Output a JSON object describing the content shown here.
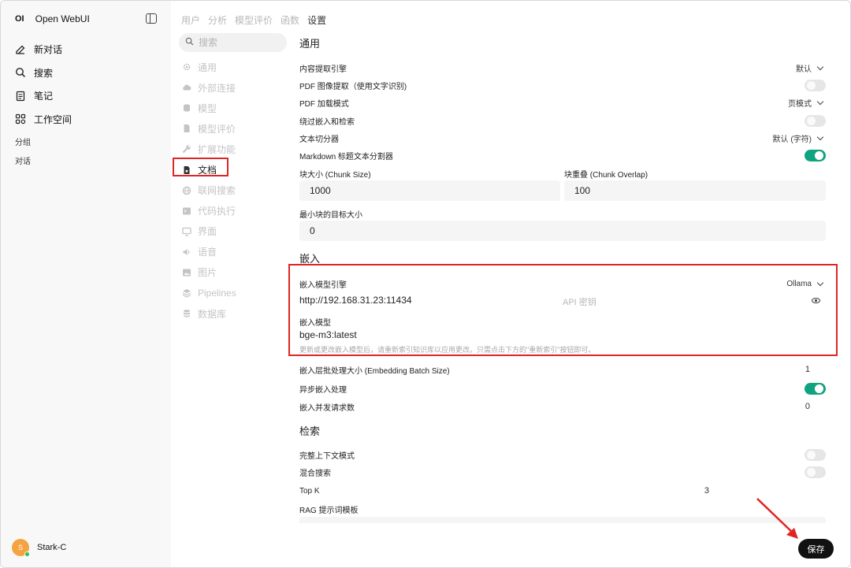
{
  "app": {
    "logo": "OI",
    "name": "Open WebUI"
  },
  "sidebar": {
    "items": [
      {
        "label": "新对话",
        "icon": "edit-icon"
      },
      {
        "label": "搜索",
        "icon": "search-icon"
      },
      {
        "label": "笔记",
        "icon": "note-icon"
      },
      {
        "label": "工作空间",
        "icon": "workspace-icon"
      }
    ],
    "groups_label": "分组",
    "chats_label": "对话",
    "user": {
      "initial": "S",
      "name": "Stark-C"
    }
  },
  "top_tabs": [
    {
      "label": "用户",
      "active": false
    },
    {
      "label": "分析",
      "active": false
    },
    {
      "label": "模型评价",
      "active": false
    },
    {
      "label": "函数",
      "active": false
    },
    {
      "label": "设置",
      "active": true
    }
  ],
  "settings_nav": {
    "search_placeholder": "搜索",
    "items": [
      {
        "label": "通用",
        "icon": "gear-icon",
        "active": false
      },
      {
        "label": "外部连接",
        "icon": "cloud-icon",
        "active": false
      },
      {
        "label": "模型",
        "icon": "stack-icon",
        "active": false
      },
      {
        "label": "模型评价",
        "icon": "document-icon",
        "active": false
      },
      {
        "label": "扩展功能",
        "icon": "wrench-icon",
        "active": false
      },
      {
        "label": "文档",
        "icon": "document-icon",
        "active": true
      },
      {
        "label": "联网搜索",
        "icon": "globe-icon",
        "active": false
      },
      {
        "label": "代码执行",
        "icon": "terminal-icon",
        "active": false
      },
      {
        "label": "界面",
        "icon": "monitor-icon",
        "active": false
      },
      {
        "label": "语音",
        "icon": "speaker-icon",
        "active": false
      },
      {
        "label": "图片",
        "icon": "image-icon",
        "active": false
      },
      {
        "label": "Pipelines",
        "icon": "layers-icon",
        "active": false
      },
      {
        "label": "数据库",
        "icon": "database-icon",
        "active": false
      }
    ]
  },
  "general": {
    "title": "通用",
    "content_engine": {
      "label": "内容提取引擎",
      "value": "默认"
    },
    "pdf_ocr": {
      "label": "PDF 图像提取（使用文字识别)",
      "enabled": false
    },
    "pdf_mode": {
      "label": "PDF 加载模式",
      "value": "页模式"
    },
    "bypass": {
      "label": "绕过嵌入和检索",
      "enabled": false
    },
    "splitter": {
      "label": "文本切分器",
      "value": "默认 (字符)"
    },
    "markdown_splitter": {
      "label": "Markdown 标题文本分割器",
      "enabled": true
    },
    "chunk_size": {
      "label": "块大小 (Chunk Size)",
      "value": "1000"
    },
    "chunk_overlap": {
      "label": "块重叠 (Chunk Overlap)",
      "value": "100"
    },
    "min_chunk": {
      "label": "最小块的目标大小",
      "value": "0"
    }
  },
  "embedding": {
    "title": "嵌入",
    "engine": {
      "label": "嵌入模型引擎",
      "value": "Ollama"
    },
    "url": "http://192.168.31.23:11434",
    "api_key_placeholder": "API 密钥",
    "model_label": "嵌入模型",
    "model_value": "bge-m3:latest",
    "hint": "更新或更改嵌入模型后，请重新索引知识库以应用更改。只需点击下方的\"重新索引\"按钮即可。",
    "batch_size": {
      "label": "嵌入层批处理大小 (Embedding Batch Size)",
      "value": "1"
    },
    "async": {
      "label": "异步嵌入处理",
      "enabled": true
    },
    "concurrency": {
      "label": "嵌入并发请求数",
      "value": "0"
    }
  },
  "retrieval": {
    "title": "检索",
    "full_context": {
      "label": "完整上下文模式",
      "enabled": false
    },
    "hybrid": {
      "label": "混合搜索",
      "enabled": false
    },
    "top_k": {
      "label": "Top K",
      "value": "3"
    },
    "rag_template": {
      "label": "RAG 提示词模板"
    }
  },
  "save_label": "保存",
  "colors": {
    "accent": "#10a37f",
    "highlight": "#e02424"
  }
}
